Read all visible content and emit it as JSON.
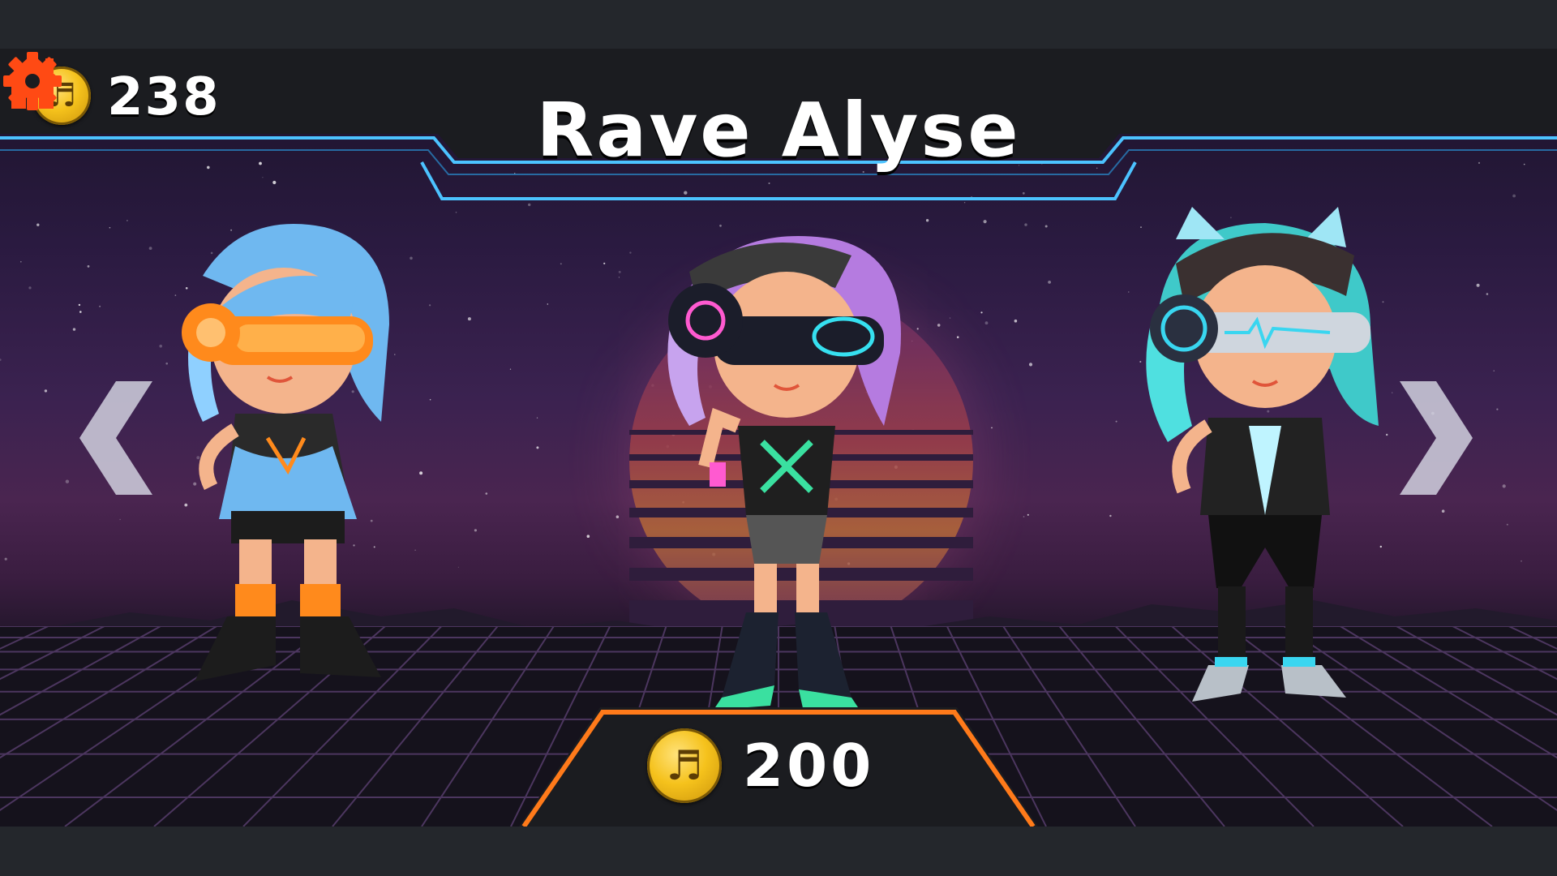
{
  "header": {
    "title": "Rave Alyse",
    "balance": "238",
    "balance_icon": "music-note-coin-icon",
    "home_icon": "home-icon",
    "settings_icon": "gear-icon"
  },
  "navigation": {
    "prev_icon": "chevron-left-icon",
    "next_icon": "chevron-right-icon"
  },
  "characters": [
    {
      "position": "previous",
      "accent": "#ff8a1c",
      "hair": "#6fb8f0"
    },
    {
      "position": "selected",
      "accent": "#ff5ad0",
      "hair": "#b57be0"
    },
    {
      "position": "next",
      "accent": "#39d6f0",
      "hair": "#3fc9c9"
    }
  ],
  "purchase": {
    "price": "200",
    "coin_icon": "music-note-coin-icon"
  },
  "colors": {
    "neon_blue": "#4cc3ff",
    "neon_orange": "#ff7a1a",
    "icon_orange": "#ff4a14",
    "coin_gold": "#f5c21c",
    "hud_dark": "#1b1c20"
  }
}
